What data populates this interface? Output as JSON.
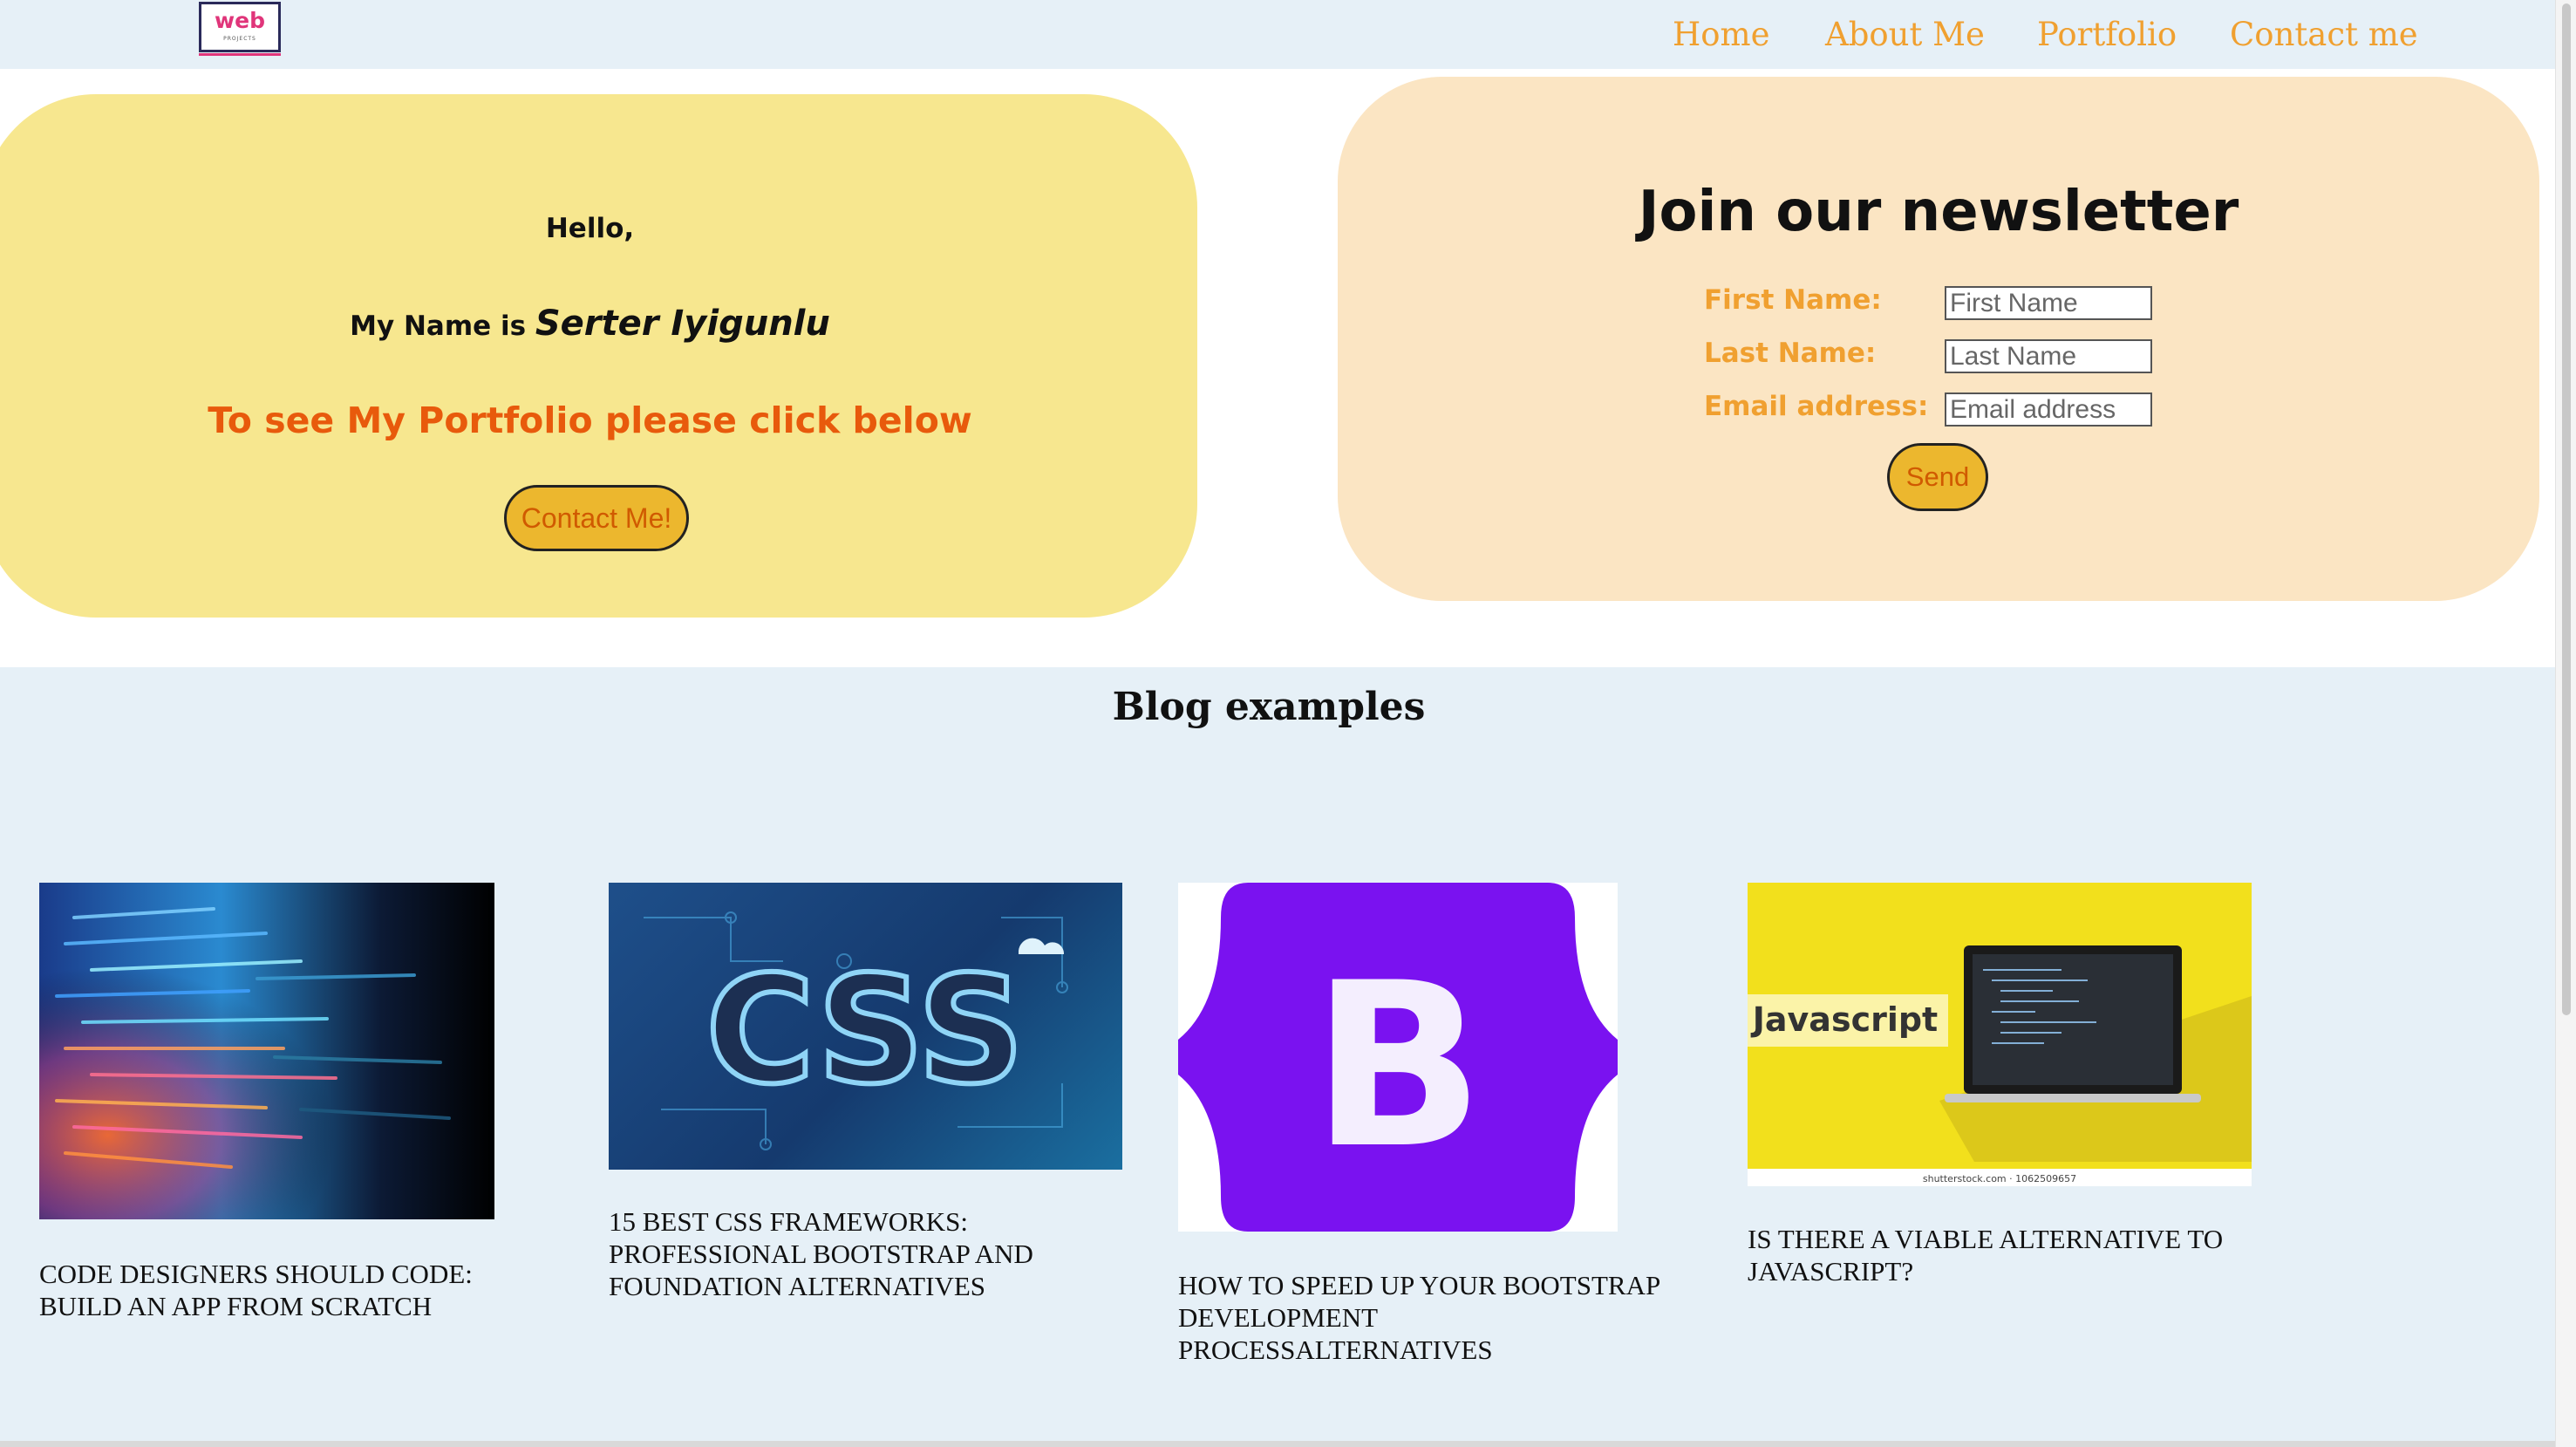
{
  "nav": {
    "logo_text": "web",
    "logo_sub": "PROJECTS",
    "links": [
      "Home",
      "About Me",
      "Portfolio",
      "Contact me"
    ]
  },
  "hero": {
    "hello": "Hello,",
    "name_prefix": "My Name is",
    "name": "Serter Iyigunlu",
    "cta": "To see My Portfolio please click below",
    "button": "Contact Me!"
  },
  "newsletter": {
    "title": "Join our newsletter",
    "fields": [
      {
        "label": "First Name:",
        "placeholder": "First Name"
      },
      {
        "label": "Last Name:",
        "placeholder": "Last Name"
      },
      {
        "label": "Email address:",
        "placeholder": "Email address"
      }
    ],
    "button": "Send"
  },
  "blog": {
    "title": "Blog examples",
    "posts": [
      {
        "caption_lines": [
          "CODE DESIGNERS SHOULD CODE:",
          "BUILD AN APP FROM SCRATCH"
        ]
      },
      {
        "caption_lines": [
          "15 BEST CSS FRAMEWORKS:",
          "PROFESSIONAL BOOTSTRAP AND",
          "FOUNDATION ALTERNATIVES"
        ],
        "image_text": "CSS"
      },
      {
        "caption_lines": [
          "HOW TO SPEED UP YOUR BOOTSTRAP",
          "DEVELOPMENT",
          "PROCESSALTERNATIVES"
        ],
        "image_text": "B"
      },
      {
        "caption_lines": [
          "IS THERE A VIABLE ALTERNATIVE TO",
          "JAVASCRIPT?"
        ],
        "image_text": "Javascript",
        "image_credit": "shutterstock.com · 1062509657"
      }
    ]
  },
  "colors": {
    "nav_bg": "#e6f0f7",
    "accent_orange": "#f0a030",
    "hero_bg": "#f7e78f",
    "news_bg": "#fbe5c3",
    "button_bg": "#ecb72e",
    "cta_text": "#e85a0c"
  }
}
